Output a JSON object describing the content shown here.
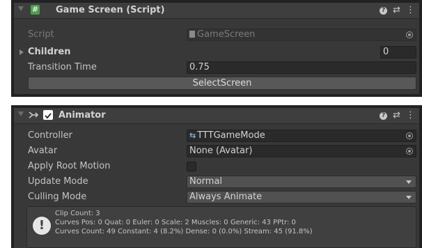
{
  "game_screen": {
    "title": "Game Screen (Script)",
    "icon": "hash-script-icon",
    "header_icons": [
      "help-icon",
      "preset-icon",
      "kebab-menu-icon"
    ],
    "script_label": "Script",
    "script_value": "GameScreen",
    "children_label": "Children",
    "children_count": "0",
    "transition_label": "Transition Time",
    "transition_value": "0.75",
    "select_button": "SelectScreen"
  },
  "animator": {
    "title": "Animator",
    "icon": "animator-icon",
    "enabled": true,
    "controller_label": "Controller",
    "controller_value": "TTTGameMode",
    "avatar_label": "Avatar",
    "avatar_value": "None (Avatar)",
    "root_motion_label": "Apply Root Motion",
    "root_motion_checked": false,
    "update_mode_label": "Update Mode",
    "update_mode_value": "Normal",
    "culling_mode_label": "Culling Mode",
    "culling_mode_value": "Always Animate",
    "info_lines": [
      "Clip Count: 3",
      "Curves Pos: 0 Quat: 0 Euler: 0 Scale: 2 Muscles: 0 Generic: 43 PPtr: 0",
      "Curves Count: 49 Constant: 4 (8.2%) Dense: 0 (0.0%) Stream: 45 (91.8%)"
    ]
  }
}
